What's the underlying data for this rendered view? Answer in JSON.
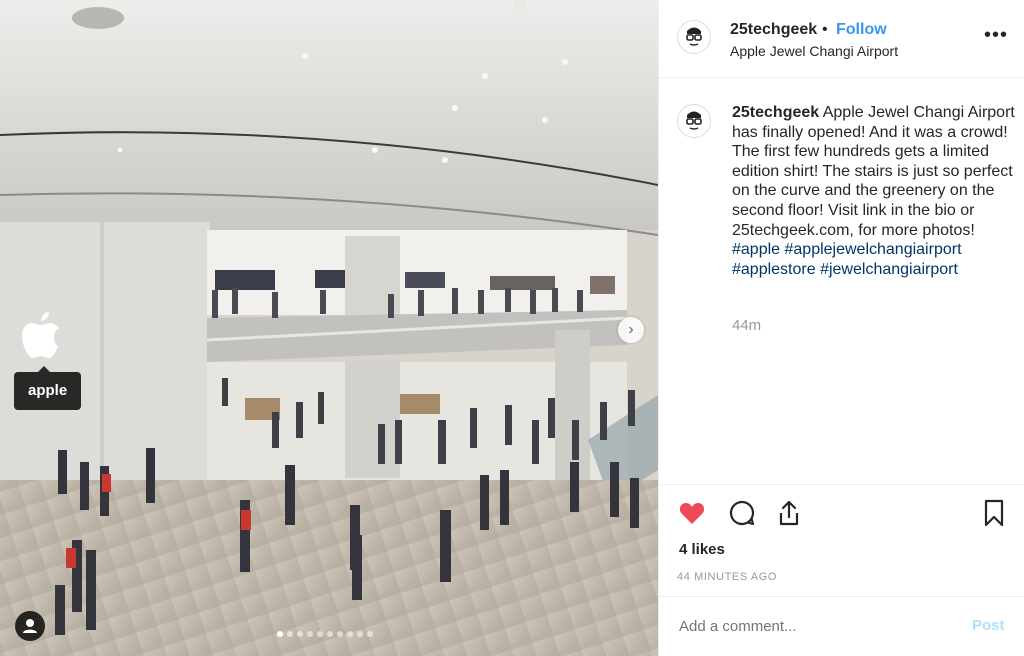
{
  "post": {
    "username": "25techgeek",
    "separator": "•",
    "follow_label": "Follow",
    "location": "Apple Jewel Changi Airport",
    "more_icon": "more-horizontal-icon",
    "caption_username": "25techgeek",
    "caption_text": " Apple Jewel Changi Airport has finally opened! And it was a crowd! The first few hundreds gets a limited edition shirt! The stairs is just so perfect on the curve and the greenery on the second floor! Visit link in the bio or 25techgeek.com, for more photos! ",
    "hashtags": [
      "#apple",
      "#applejewelchangiairport",
      "#applestore",
      "#jewelchangiairport"
    ],
    "relative_time": "44m",
    "likes": "4 likes",
    "timestamp": "44 MINUTES AGO",
    "liked": true
  },
  "photo": {
    "tag_label": "apple",
    "carousel_count": 10,
    "carousel_active_index": 0
  },
  "comment": {
    "placeholder": "Add a comment...",
    "post_label": "Post"
  },
  "colors": {
    "link_blue": "#3897f0",
    "hashtag": "#003569",
    "like_red": "#ed4956",
    "muted": "#999999",
    "post_disabled": "#b2dffc"
  }
}
